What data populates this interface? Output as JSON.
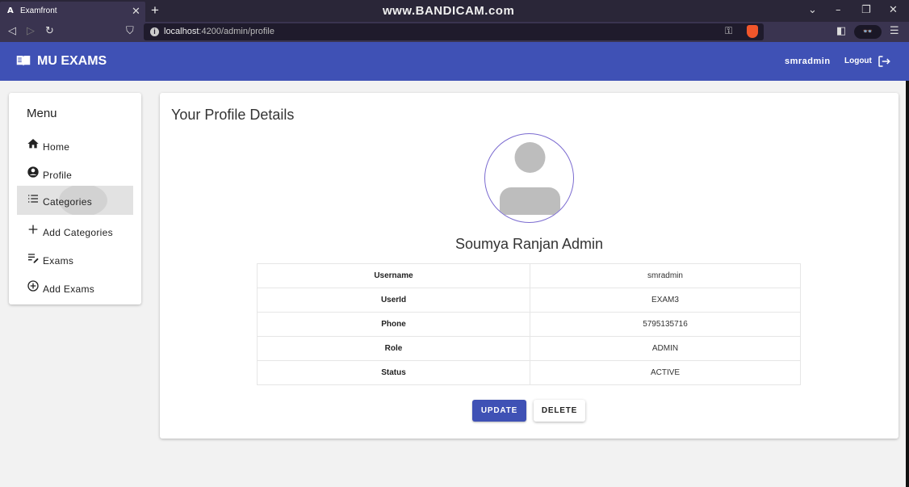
{
  "browser": {
    "tab_logo": "A",
    "tab_title": "Examfront",
    "tab_close": "✕",
    "new_tab": "+",
    "watermark": "www.BANDICAM.com",
    "url_host": "localhost",
    "url_path": ":4200/admin/profile",
    "extension_label": "👓"
  },
  "header": {
    "brand": "MU EXAMS",
    "username": "smradmin",
    "logout_label": "Logout"
  },
  "sidebar": {
    "title": "Menu",
    "items": [
      {
        "label": "Home",
        "icon": "home-icon"
      },
      {
        "label": "Profile",
        "icon": "account-circle-icon"
      },
      {
        "label": "Categories",
        "icon": "list-icon",
        "active": true
      },
      {
        "label": "Add Categories",
        "icon": "plus-icon"
      },
      {
        "label": "Exams",
        "icon": "playlist-edit-icon"
      },
      {
        "label": "Add Exams",
        "icon": "add-circle-icon"
      }
    ]
  },
  "profile": {
    "title": "Your Profile Details",
    "full_name": "Soumya Ranjan Admin",
    "details": [
      {
        "key": "Username",
        "value": "smradmin"
      },
      {
        "key": "UserId",
        "value": "EXAM3"
      },
      {
        "key": "Phone",
        "value": "5795135716"
      },
      {
        "key": "Role",
        "value": "ADMIN"
      },
      {
        "key": "Status",
        "value": "ACTIVE"
      }
    ],
    "update_label": "UPDATE",
    "delete_label": "DELETE"
  },
  "colors": {
    "primary": "#3f51b5",
    "browser_dark": "#2a2638",
    "active_item": "#e2e2e2"
  }
}
